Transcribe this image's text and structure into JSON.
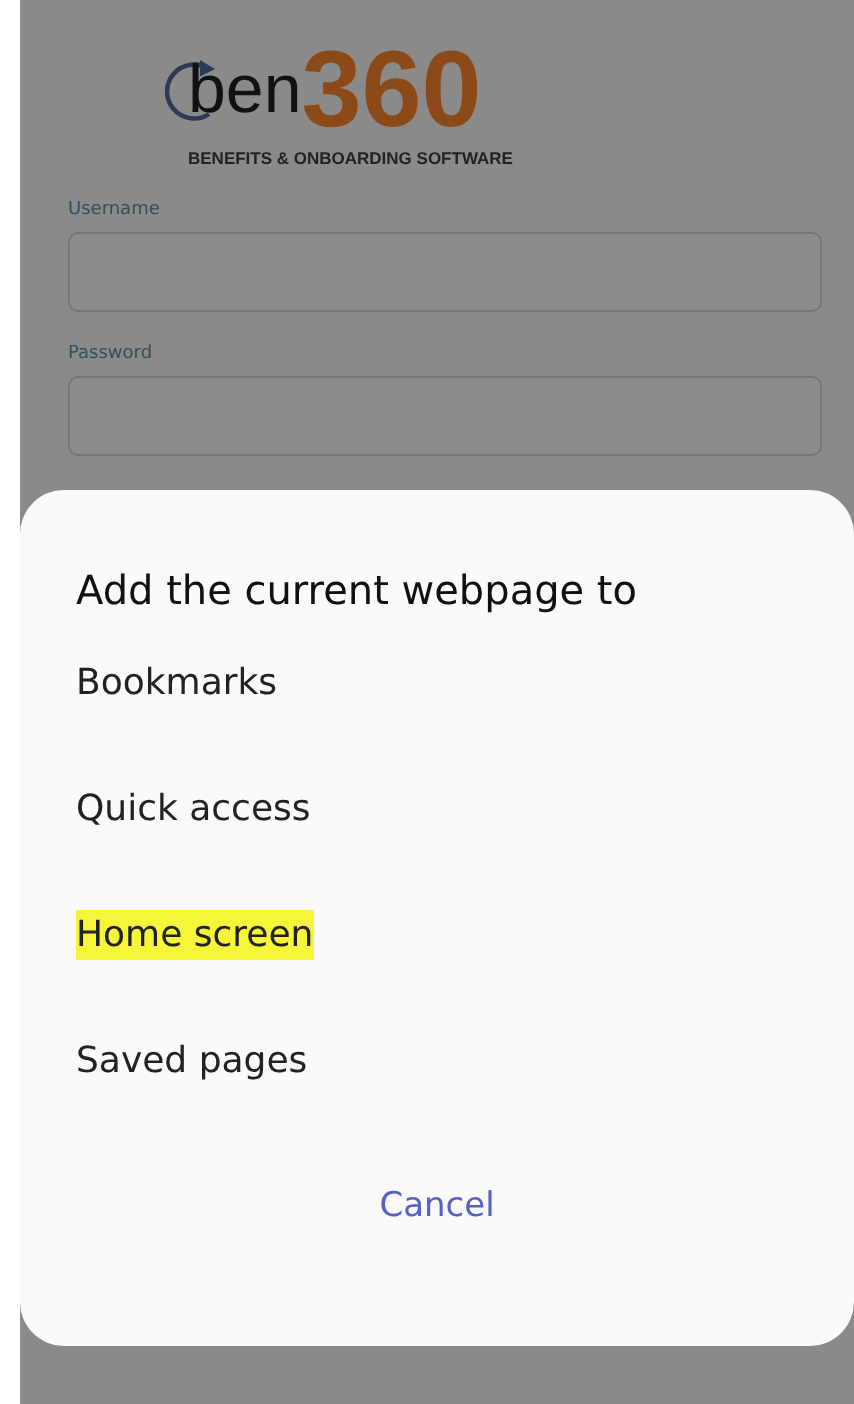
{
  "logo": {
    "prefix": "ben",
    "number": "360",
    "tagline": "BENEFITS & ONBOARDING SOFTWARE"
  },
  "login_form": {
    "fields": [
      {
        "label": "Username"
      },
      {
        "label": "Password"
      }
    ]
  },
  "sheet": {
    "title": "Add the current webpage to",
    "options": [
      {
        "label": "Bookmarks",
        "highlighted": false
      },
      {
        "label": "Quick access",
        "highlighted": false
      },
      {
        "label": "Home screen",
        "highlighted": true
      },
      {
        "label": "Saved pages",
        "highlighted": false
      }
    ],
    "cancel": "Cancel"
  }
}
